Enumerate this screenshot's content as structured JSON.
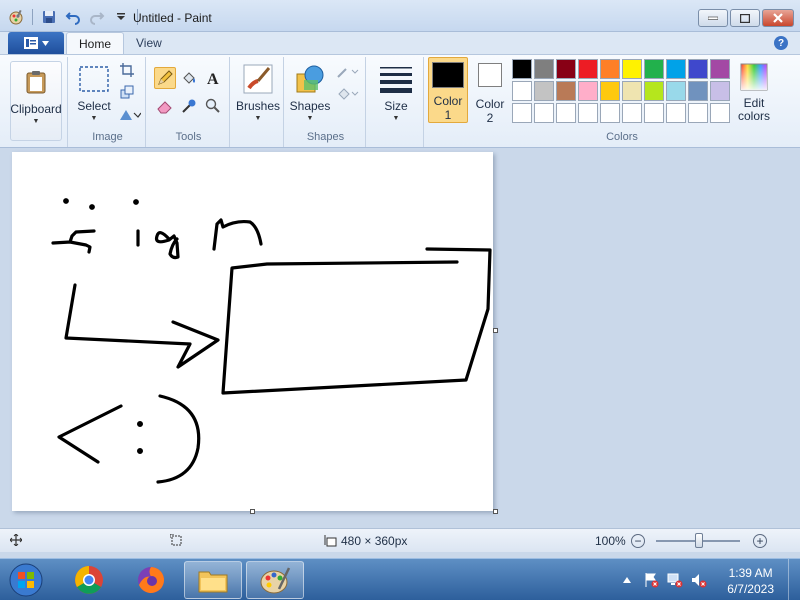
{
  "window": {
    "title": "Untitled - Paint"
  },
  "tabs": {
    "home": "Home",
    "view": "View"
  },
  "ribbon": {
    "clipboard": {
      "label": "Clipboard",
      "group": ""
    },
    "image": {
      "select_label": "Select",
      "group": "Image"
    },
    "tools": {
      "group": "Tools"
    },
    "brushes": {
      "label": "Brushes"
    },
    "shapes": {
      "label": "Shapes",
      "group": "Shapes"
    },
    "size": {
      "label": "Size"
    },
    "color1": {
      "label_line1": "Color",
      "label_line2": "1",
      "value": "#000000"
    },
    "color2": {
      "label_line1": "Color",
      "label_line2": "2",
      "value": "#ffffff"
    },
    "colors_group": "Colors",
    "edit_colors": {
      "line1": "Edit",
      "line2": "colors"
    },
    "palette": [
      "#000000",
      "#7f7f7f",
      "#880015",
      "#ed1c24",
      "#ff7f27",
      "#fff200",
      "#22b14c",
      "#00a2e8",
      "#3f48cc",
      "#a349a4",
      "#ffffff",
      "#c3c3c3",
      "#b97a57",
      "#ffaec9",
      "#ffc90e",
      "#efe4b0",
      "#b5e61d",
      "#99d9ea",
      "#7092be",
      "#c8bfe7",
      "#ffffff",
      "#ffffff",
      "#ffffff",
      "#ffffff",
      "#ffffff",
      "#ffffff",
      "#ffffff",
      "#ffffff",
      "#ffffff",
      "#ffffff"
    ]
  },
  "canvas": {
    "drawn_text": "sign"
  },
  "status": {
    "dimensions": "480 × 360px",
    "zoom": "100%"
  },
  "taskbar": {
    "time": "1:39 AM",
    "date": "6/7/2023"
  }
}
